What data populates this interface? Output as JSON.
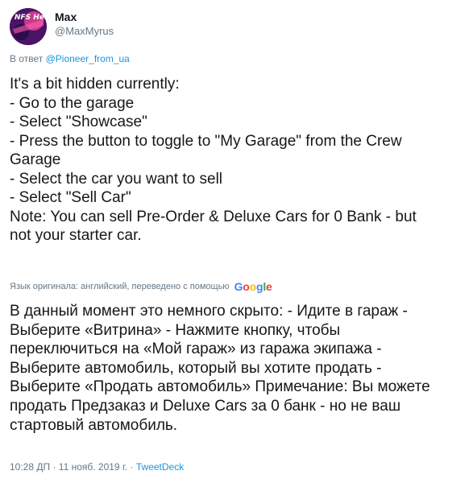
{
  "author": {
    "name": "Max",
    "handle": "@MaxMyrus",
    "avatar_text": "NFS Heat"
  },
  "reply": {
    "prefix": "В ответ",
    "to": "@Pioneer_from_ua"
  },
  "tweet_lines": [
    "It's a bit hidden currently:",
    "- Go to the garage",
    "- Select \"Showcase\"",
    "- Press the button to toggle to \"My Garage\" from the Crew",
    "Garage",
    "- Select the car you want to sell",
    "- Select \"Sell Car\"",
    "Note: You can sell Pre-Order & Deluxe Cars for 0 Bank - but",
    "not your starter car."
  ],
  "translation": {
    "note": "Язык оригинала: английский, переведено с помощью",
    "logo": "Google",
    "lines": [
      "В данный момент это немного скрыто: - Идите в гараж -",
      "Выберите «Витрина» - Нажмите кнопку, чтобы",
      "переключиться на «Мой гараж» из гаража экипажа -",
      "Выберите автомобиль, который вы хотите продать -",
      "Выберите «Продать автомобиль» Примечание: Вы можете",
      "продать Предзаказ и Deluxe Cars за 0 банк - но не ваш",
      "стартовый автомобиль."
    ]
  },
  "meta": {
    "timestamp": "10:28 ДП · 11 нояб. 2019 г.",
    "separator": " · ",
    "source": "TweetDeck"
  },
  "colors": {
    "text": "#14171a",
    "secondary": "#657786",
    "link": "#1b95e0"
  }
}
